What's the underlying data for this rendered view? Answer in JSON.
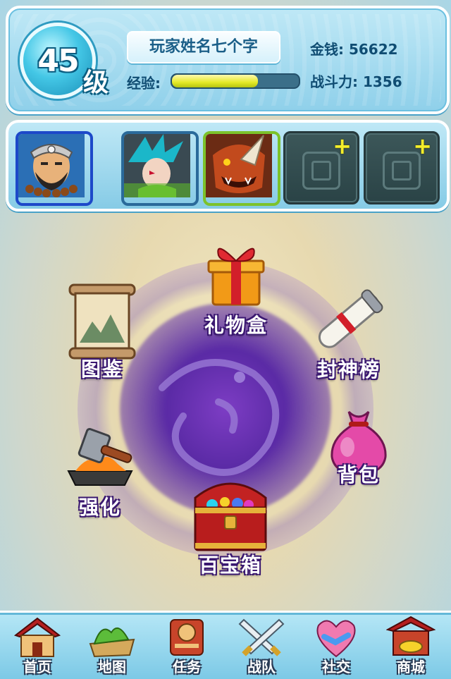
{
  "player": {
    "level": "45",
    "level_unit": "级",
    "name": "玩家姓名七个字",
    "exp_label": "经验:",
    "exp_progress": 0.68,
    "gold": "金钱: 56622",
    "power": "战斗力: 1356"
  },
  "team": {
    "slots": [
      {
        "type": "hero",
        "icon": "bearded-warrior-portrait"
      },
      {
        "type": "hero",
        "icon": "blue-haired-hero-portrait"
      },
      {
        "type": "hero",
        "icon": "rhino-demon-portrait"
      },
      {
        "type": "empty",
        "icon": "add-slot-plus"
      },
      {
        "type": "empty",
        "icon": "add-slot-plus"
      }
    ],
    "add_symbol": "+"
  },
  "menu": {
    "gift_box": "礼物盒",
    "atlas": "图鉴",
    "rankings": "封神榜",
    "enhance": "强化",
    "backpack": "背包",
    "treasure_chest": "百宝箱"
  },
  "nav": {
    "home": "首页",
    "map": "地图",
    "tasks": "任务",
    "team": "战队",
    "social": "社交",
    "shop": "商城"
  },
  "colors": {
    "panel_blue": "#8fd0ea",
    "exp_yellow": "#e4ea27",
    "orb_purple": "#5a2aa5",
    "label_outline": "#3a1870"
  }
}
